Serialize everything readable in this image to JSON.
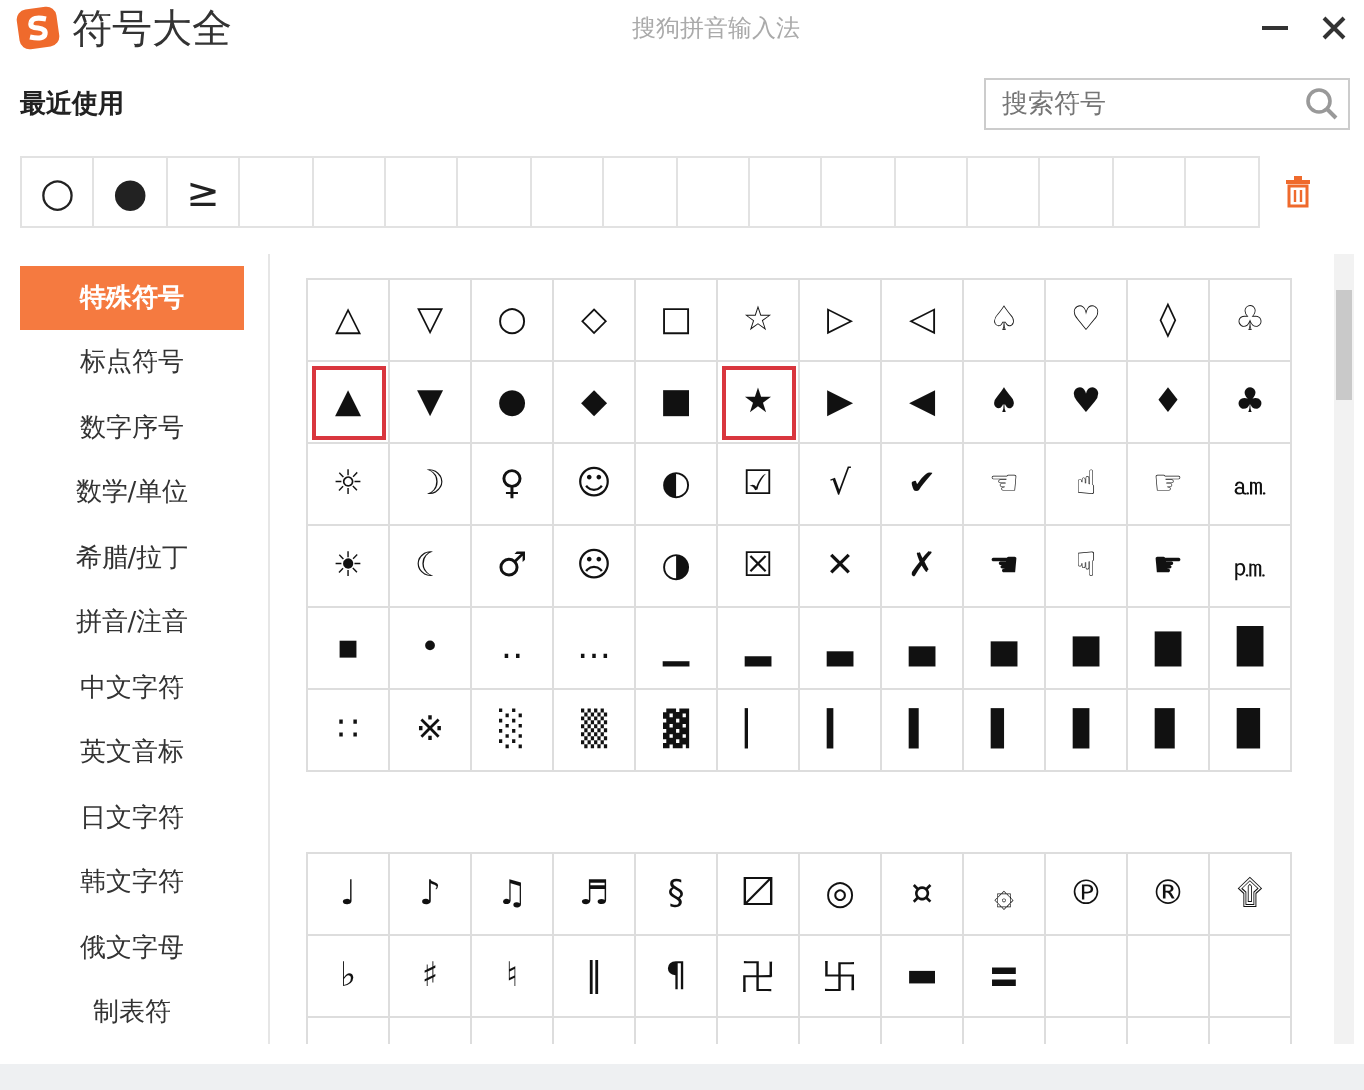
{
  "window": {
    "title": "符号大全",
    "app_name": "搜狗拼音输入法"
  },
  "recent": {
    "label": "最近使用",
    "symbols": [
      "○",
      "●",
      "≥"
    ]
  },
  "search": {
    "placeholder": "搜索符号"
  },
  "sidebar": {
    "items": [
      {
        "label": "特殊符号",
        "selected": true
      },
      {
        "label": "标点符号",
        "selected": false
      },
      {
        "label": "数字序号",
        "selected": false
      },
      {
        "label": "数学/单位",
        "selected": false
      },
      {
        "label": "希腊/拉丁",
        "selected": false
      },
      {
        "label": "拼音/注音",
        "selected": false
      },
      {
        "label": "中文字符",
        "selected": false
      },
      {
        "label": "英文音标",
        "selected": false
      },
      {
        "label": "日文字符",
        "selected": false
      },
      {
        "label": "韩文字符",
        "selected": false
      },
      {
        "label": "俄文字母",
        "selected": false
      },
      {
        "label": "制表符",
        "selected": false
      }
    ]
  },
  "grids": [
    {
      "rows": [
        [
          {
            "symbol": "△",
            "selected": false
          },
          {
            "symbol": "▽",
            "selected": false
          },
          {
            "symbol": "○",
            "selected": false
          },
          {
            "symbol": "◇",
            "selected": false
          },
          {
            "symbol": "□",
            "selected": false
          },
          {
            "symbol": "☆",
            "selected": false
          },
          {
            "symbol": "▷",
            "selected": false
          },
          {
            "symbol": "◁",
            "selected": false
          },
          {
            "symbol": "♤",
            "selected": false
          },
          {
            "symbol": "♡",
            "selected": false
          },
          {
            "symbol": "◊",
            "selected": false
          },
          {
            "symbol": "♧",
            "selected": false
          }
        ],
        [
          {
            "symbol": "▲",
            "selected": true
          },
          {
            "symbol": "▼",
            "selected": false
          },
          {
            "symbol": "●",
            "selected": false
          },
          {
            "symbol": "◆",
            "selected": false
          },
          {
            "symbol": "■",
            "selected": false
          },
          {
            "symbol": "★",
            "selected": true
          },
          {
            "symbol": "▶",
            "selected": false
          },
          {
            "symbol": "◀",
            "selected": false
          },
          {
            "symbol": "♠",
            "selected": false
          },
          {
            "symbol": "♥",
            "selected": false
          },
          {
            "symbol": "♦",
            "selected": false
          },
          {
            "symbol": "♣",
            "selected": false
          }
        ],
        [
          {
            "symbol": "☼",
            "selected": false
          },
          {
            "symbol": "☽",
            "selected": false
          },
          {
            "symbol": "♀",
            "selected": false
          },
          {
            "symbol": "☺",
            "selected": false
          },
          {
            "symbol": "◐",
            "selected": false
          },
          {
            "symbol": "☑",
            "selected": false
          },
          {
            "symbol": "√",
            "selected": false
          },
          {
            "symbol": "✔",
            "selected": false
          },
          {
            "symbol": "☜",
            "selected": false
          },
          {
            "symbol": "☝",
            "selected": false
          },
          {
            "symbol": "☞",
            "selected": false
          },
          {
            "symbol": "㏂",
            "selected": false
          }
        ],
        [
          {
            "symbol": "☀",
            "selected": false
          },
          {
            "symbol": "☾",
            "selected": false
          },
          {
            "symbol": "♂",
            "selected": false
          },
          {
            "symbol": "☹",
            "selected": false
          },
          {
            "symbol": "◑",
            "selected": false
          },
          {
            "symbol": "☒",
            "selected": false
          },
          {
            "symbol": "✕",
            "selected": false
          },
          {
            "symbol": "✗",
            "selected": false
          },
          {
            "symbol": "☚",
            "selected": false
          },
          {
            "symbol": "☟",
            "selected": false
          },
          {
            "symbol": "☛",
            "selected": false
          },
          {
            "symbol": "㏘",
            "selected": false
          }
        ],
        [
          {
            "symbol": "▪",
            "selected": false
          },
          {
            "symbol": "•",
            "selected": false
          },
          {
            "symbol": "‥",
            "selected": false
          },
          {
            "symbol": "…",
            "selected": false
          },
          {
            "symbol": "▁",
            "selected": false
          },
          {
            "symbol": "▂",
            "selected": false
          },
          {
            "symbol": "▃",
            "selected": false
          },
          {
            "symbol": "▄",
            "selected": false
          },
          {
            "symbol": "▅",
            "selected": false
          },
          {
            "symbol": "▆",
            "selected": false
          },
          {
            "symbol": "▇",
            "selected": false
          },
          {
            "symbol": "█",
            "selected": false
          }
        ],
        [
          {
            "symbol": "∷",
            "selected": false
          },
          {
            "symbol": "※",
            "selected": false
          },
          {
            "symbol": "░",
            "selected": false
          },
          {
            "symbol": "▒",
            "selected": false
          },
          {
            "symbol": "▓",
            "selected": false
          },
          {
            "symbol": "▏",
            "selected": false
          },
          {
            "symbol": "▎",
            "selected": false
          },
          {
            "symbol": "▍",
            "selected": false
          },
          {
            "symbol": "▌",
            "selected": false
          },
          {
            "symbol": "▋",
            "selected": false
          },
          {
            "symbol": "▊",
            "selected": false
          },
          {
            "symbol": "▉",
            "selected": false
          }
        ]
      ]
    },
    {
      "rows": [
        [
          {
            "symbol": "♩",
            "selected": false
          },
          {
            "symbol": "♪",
            "selected": false
          },
          {
            "symbol": "♫",
            "selected": false
          },
          {
            "symbol": "♬",
            "selected": false
          },
          {
            "symbol": "§",
            "selected": false
          },
          {
            "symbol": "〼",
            "selected": false
          },
          {
            "symbol": "◎",
            "selected": false
          },
          {
            "symbol": "¤",
            "selected": false
          },
          {
            "symbol": "۞",
            "selected": false
          },
          {
            "symbol": "℗",
            "selected": false
          },
          {
            "symbol": "®",
            "selected": false
          },
          {
            "symbol": "۩",
            "selected": false
          }
        ],
        [
          {
            "symbol": "♭",
            "selected": false
          },
          {
            "symbol": "♯",
            "selected": false
          },
          {
            "symbol": "♮",
            "selected": false
          },
          {
            "symbol": "‖",
            "selected": false
          },
          {
            "symbol": "¶",
            "selected": false
          },
          {
            "symbol": "卍",
            "selected": false
          },
          {
            "symbol": "卐",
            "selected": false
          },
          {
            "symbol": "▬",
            "selected": false
          },
          {
            "symbol": "〓",
            "selected": false
          }
        ]
      ]
    }
  ]
}
